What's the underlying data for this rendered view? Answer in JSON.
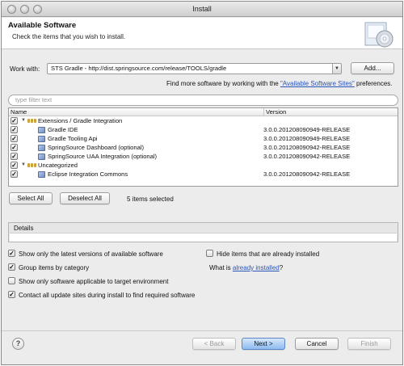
{
  "window": {
    "title": "Install"
  },
  "banner": {
    "title": "Available Software",
    "description": "Check the items that you wish to install."
  },
  "work_with": {
    "label": "Work with:",
    "value": "STS Gradle - http://dist.springsource.com/release/TOOLS/gradle",
    "add_button": "Add..."
  },
  "more_sites": {
    "prefix": "Find more software by working with the",
    "link": "\"Available Software Sites\"",
    "suffix": "preferences."
  },
  "filter": {
    "placeholder": "type filter text"
  },
  "tree": {
    "columns": {
      "name": "Name",
      "version": "Version"
    },
    "groups": [
      {
        "name": "Extensions / Gradle Integration",
        "checked": true,
        "items": [
          {
            "name": "Gradle IDE",
            "version": "3.0.0.201208090949-RELEASE",
            "checked": true
          },
          {
            "name": "Gradle Tooling Api",
            "version": "3.0.0.201208090949-RELEASE",
            "checked": true
          },
          {
            "name": "SpringSource Dashboard (optional)",
            "version": "3.0.0.201208090942-RELEASE",
            "checked": true
          },
          {
            "name": "SpringSource UAA Integration (optional)",
            "version": "3.0.0.201208090942-RELEASE",
            "checked": true
          }
        ]
      },
      {
        "name": "Uncategorized",
        "checked": true,
        "items": [
          {
            "name": "Eclipse Integration Commons",
            "version": "3.0.0.201208090942-RELEASE",
            "checked": true
          }
        ]
      }
    ]
  },
  "selection": {
    "select_all": "Select All",
    "deselect_all": "Deselect All",
    "status": "5 items selected"
  },
  "details": {
    "label": "Details"
  },
  "options": {
    "latest_only": "Show only the latest versions of available software",
    "group_by_category": "Group items by category",
    "target_env": "Show only software applicable to target environment",
    "contact_sites": "Contact all update sites during install to find required software",
    "hide_installed": "Hide items that are already installed",
    "what_is_prefix": "What is",
    "already_installed_link": "already installed",
    "what_is_suffix": "?"
  },
  "footer": {
    "back": "< Back",
    "next": "Next >",
    "cancel": "Cancel",
    "finish": "Finish"
  }
}
